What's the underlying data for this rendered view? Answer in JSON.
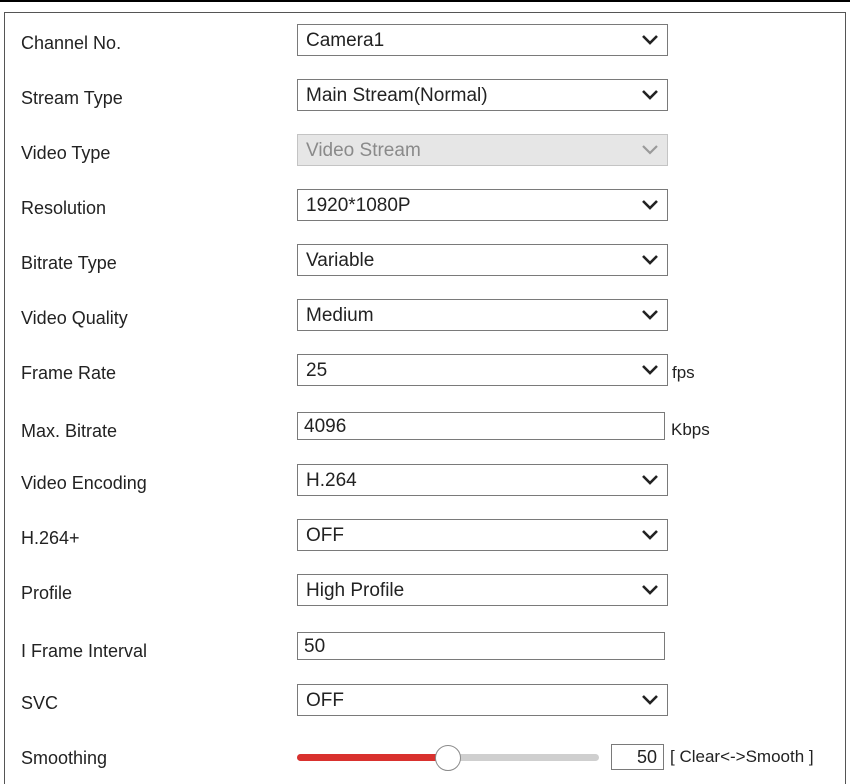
{
  "fields": {
    "channel": {
      "label": "Channel No.",
      "value": "Camera1"
    },
    "stream_type": {
      "label": "Stream Type",
      "value": "Main Stream(Normal)"
    },
    "video_type": {
      "label": "Video Type",
      "value": "Video Stream"
    },
    "resolution": {
      "label": "Resolution",
      "value": "1920*1080P"
    },
    "bitrate_type": {
      "label": "Bitrate Type",
      "value": "Variable"
    },
    "video_quality": {
      "label": "Video Quality",
      "value": "Medium"
    },
    "frame_rate": {
      "label": "Frame Rate",
      "value": "25",
      "unit": "fps"
    },
    "max_bitrate": {
      "label": "Max. Bitrate",
      "value": "4096",
      "unit": "Kbps"
    },
    "video_encoding": {
      "label": "Video Encoding",
      "value": "H.264"
    },
    "h264_plus": {
      "label": "H.264+",
      "value": "OFF"
    },
    "profile": {
      "label": "Profile",
      "value": "High Profile"
    },
    "i_frame_interval": {
      "label": "I Frame Interval",
      "value": "50"
    },
    "svc": {
      "label": "SVC",
      "value": "OFF"
    },
    "smoothing": {
      "label": "Smoothing",
      "value": "50",
      "level_fraction": 0.5,
      "hint": "[ Clear<->Smooth ]"
    }
  },
  "colors": {
    "slider_fill": "#d9312e",
    "slider_track": "#cfcfcf",
    "disabled_bg": "#e6e6e6"
  },
  "icons": {
    "dropdown": "chevron-down-icon"
  }
}
